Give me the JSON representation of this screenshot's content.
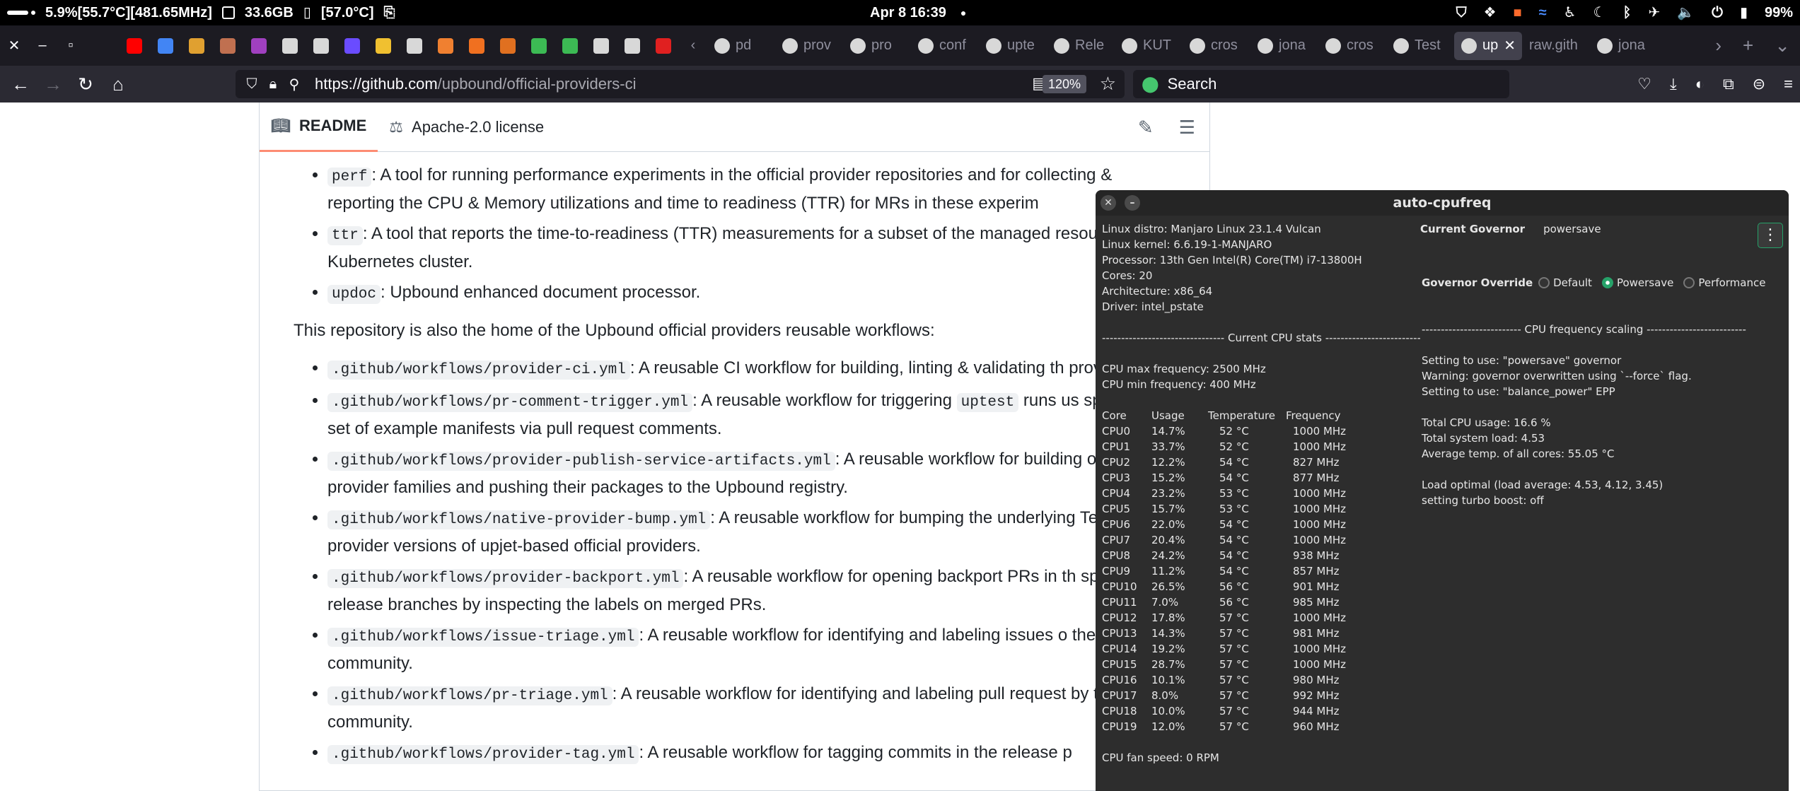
{
  "system_panel": {
    "stats": "5.9%[55.7°C][481.65MHz]",
    "memory": "33.6GB",
    "disk": "[57.0°C]",
    "datetime": "Apr 8  16:39",
    "battery": "99%"
  },
  "tabs": {
    "pinned_colors": [
      "#ff0000",
      "#4285f4",
      "#e0a030",
      "#c07050",
      "#a040c0",
      "#d8d8d8",
      "#d8d8d8",
      "#6a4cff",
      "#f0c030",
      "#d8d8d8",
      "#f08030",
      "#f07020",
      "#e07020",
      "#3cba54",
      "#3cba54",
      "#d8d8d8",
      "#d8d8d8",
      "#e02020"
    ],
    "items": [
      {
        "label": "pd",
        "icon": "document-icon",
        "active": false
      },
      {
        "label": "prov",
        "icon": "github-icon",
        "active": false
      },
      {
        "label": "pro",
        "icon": "github-icon",
        "active": false
      },
      {
        "label": "conf",
        "icon": "github-icon",
        "active": false
      },
      {
        "label": "upte",
        "icon": "google-icon",
        "active": false
      },
      {
        "label": "Rele",
        "icon": "github-icon",
        "active": false
      },
      {
        "label": "KUT",
        "icon": "kut-icon",
        "active": false
      },
      {
        "label": "cros",
        "icon": "github-icon",
        "active": false
      },
      {
        "label": "jona",
        "icon": "github-icon",
        "active": false
      },
      {
        "label": "cros",
        "icon": "google-icon",
        "active": false
      },
      {
        "label": "Test",
        "icon": "avatar-icon",
        "active": false
      },
      {
        "label": "up",
        "icon": "github-icon",
        "active": true
      },
      {
        "label": "raw.gith",
        "icon": "none",
        "active": false
      },
      {
        "label": "jona",
        "icon": "github-icon",
        "active": false
      }
    ]
  },
  "navbar": {
    "url_host": "https://github.com",
    "url_path": "/upbound/official-providers-ci",
    "zoom": "120%",
    "search_placeholder": "Search"
  },
  "readme": {
    "tab_readme": "README",
    "tab_license": "Apache-2.0 license",
    "tools": [
      {
        "code": "perf",
        "text": ": A tool for running performance experiments in the official provider repositories and for collecting & reporting the CPU & Memory utilizations and time to readiness (TTR) for MRs in these experim"
      },
      {
        "code": "ttr",
        "text": ": A tool that reports the time-to-readiness (TTR) measurements for a subset of the managed resources in a Kubernetes cluster."
      },
      {
        "code": "updoc",
        "text": ": Upbound enhanced document processor."
      }
    ],
    "paragraph": "This repository is also the home of the Upbound official providers reusable workflows:",
    "workflows": [
      {
        "code": ".github/workflows/provider-ci.yml",
        "text": ": A reusable CI workflow for building, linting & validating th providers."
      },
      {
        "code": ".github/workflows/pr-comment-trigger.yml",
        "text": ": A reusable workflow for triggering",
        "code2": "uptest",
        "text2": "runs us specified set of example manifests via pull request comments."
      },
      {
        "code": ".github/workflows/provider-publish-service-artifacts.yml",
        "text": ": A reusable workflow for building official provider families and pushing their packages to the Upbound registry."
      },
      {
        "code": ".github/workflows/native-provider-bump.yml",
        "text": ": A reusable workflow for bumping the underlying Terraform provider versions of upjet-based official providers."
      },
      {
        "code": ".github/workflows/provider-backport.yml",
        "text": ": A reusable workflow for opening backport PRs in th specified release branches by inspecting the labels on merged PRs."
      },
      {
        "code": ".github/workflows/issue-triage.yml",
        "text": ": A reusable workflow for identifying and labeling issues o the community."
      },
      {
        "code": ".github/workflows/pr-triage.yml",
        "text": ": A reusable workflow for identifying and labeling pull request by the community."
      },
      {
        "code": ".github/workflows/provider-tag.yml",
        "text": ": A reusable workflow for tagging commits in the release p"
      }
    ]
  },
  "cpufreq": {
    "title": "auto-cpufreq",
    "sysinfo": [
      "Linux distro: Manjaro Linux 23.1.4 Vulcan",
      "Linux kernel: 6.6.19-1-MANJARO",
      "Processor: 13th Gen Intel(R) Core(TM) i7-13800H",
      "Cores: 20",
      "Architecture: x86_64",
      "Driver: intel_pstate"
    ],
    "stats_header": "-------------------------------- Current CPU stats --------------------------------",
    "max_freq": "CPU max frequency: 2500 MHz",
    "min_freq": "CPU min frequency: 400 MHz",
    "columns": [
      "Core",
      "Usage",
      "Temperature",
      "Frequency"
    ],
    "cores": [
      [
        "CPU0",
        "14.7%",
        "52 °C",
        "1000 MHz"
      ],
      [
        "CPU1",
        "33.7%",
        "52 °C",
        "1000 MHz"
      ],
      [
        "CPU2",
        "12.2%",
        "54 °C",
        "827 MHz"
      ],
      [
        "CPU3",
        "15.2%",
        "54 °C",
        "877 MHz"
      ],
      [
        "CPU4",
        "23.2%",
        "53 °C",
        "1000 MHz"
      ],
      [
        "CPU5",
        "15.7%",
        "53 °C",
        "1000 MHz"
      ],
      [
        "CPU6",
        "22.0%",
        "54 °C",
        "1000 MHz"
      ],
      [
        "CPU7",
        "20.4%",
        "54 °C",
        "1000 MHz"
      ],
      [
        "CPU8",
        "24.2%",
        "54 °C",
        "938 MHz"
      ],
      [
        "CPU9",
        "11.2%",
        "54 °C",
        "857 MHz"
      ],
      [
        "CPU10",
        "26.5%",
        "56 °C",
        "901 MHz"
      ],
      [
        "CPU11",
        "7.0%",
        "56 °C",
        "985 MHz"
      ],
      [
        "CPU12",
        "17.8%",
        "57 °C",
        "1000 MHz"
      ],
      [
        "CPU13",
        "14.3%",
        "57 °C",
        "981 MHz"
      ],
      [
        "CPU14",
        "19.2%",
        "57 °C",
        "1000 MHz"
      ],
      [
        "CPU15",
        "28.7%",
        "57 °C",
        "1000 MHz"
      ],
      [
        "CPU16",
        "10.1%",
        "57 °C",
        "980 MHz"
      ],
      [
        "CPU17",
        "8.0%",
        "57 °C",
        "992 MHz"
      ],
      [
        "CPU18",
        "10.0%",
        "57 °C",
        "944 MHz"
      ],
      [
        "CPU19",
        "12.0%",
        "57 °C",
        "960 MHz"
      ]
    ],
    "fan_speed": "CPU fan speed: 0 RPM",
    "governor_label": "Current Governor",
    "governor_value": "powersave",
    "override_label": "Governor Override",
    "override_options": [
      "Default",
      "Powersave",
      "Performance"
    ],
    "override_selected": "Powersave",
    "scaling_header": "-------------------------- CPU frequency scaling --------------------------",
    "scaling_lines": [
      "Setting to use: \"powersave\" governor",
      "Warning: governor overwritten using `--force` flag.",
      "Setting to use: \"balance_power\" EPP"
    ],
    "usage_lines": [
      "Total CPU usage: 16.6 %",
      "Total system load: 4.53",
      "Average temp. of all cores: 55.05 °C"
    ],
    "load_lines": [
      "Load optimal (load average: 4.53, 4.12, 3.45)",
      "setting turbo boost: off"
    ]
  }
}
